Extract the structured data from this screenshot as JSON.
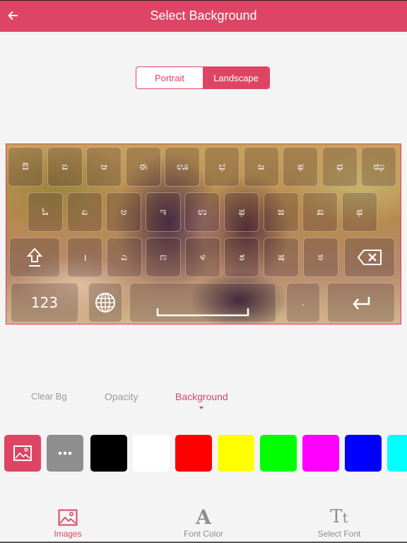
{
  "header": {
    "title": "Select Background",
    "back_icon": "arrow-left-icon"
  },
  "orientation": {
    "options": [
      "Portrait",
      "Landscape"
    ],
    "selected": "Landscape"
  },
  "keyboard": {
    "row1": [
      "ಔ",
      "ಐ",
      "ಆ",
      "ಈ",
      "ಊ",
      "ಭ",
      "ಜ",
      "ಫ",
      "ಧ",
      "ಝ"
    ],
    "row2": [
      "ಓ",
      "ಏ",
      "ಅ",
      "ಇ",
      "ಉ",
      "ಫ",
      "ಙ",
      "ಖ",
      "ಥ"
    ],
    "row3": {
      "shift_icon": "shift-icon",
      "keys": [
        "।",
        "ಎ",
        "ಣ",
        "ಳ",
        "ಶ",
        "ಷ",
        "ಠ"
      ],
      "backspace_icon": "backspace-icon"
    },
    "row4": {
      "numbers_label": "123",
      "globe_icon": "globe-icon",
      "space_icon": "space-bar-icon",
      "period": ".",
      "enter_icon": "enter-icon"
    }
  },
  "tabs": [
    {
      "label": "Clear Bg",
      "active": false
    },
    {
      "label": "Opacity",
      "active": false
    },
    {
      "label": "Background",
      "active": true
    }
  ],
  "swatches": {
    "image_button_icon": "image-icon",
    "more_button_icon": "more-dots-icon",
    "colors": [
      "#000000",
      "#ffffff",
      "#ff0000",
      "#ffff00",
      "#00ff00",
      "#ff00ff",
      "#0000ff",
      "#00ffff"
    ],
    "image_button_color": "#de4565",
    "more_button_color": "#8e8e8e"
  },
  "bottom_nav": [
    {
      "label": "Images",
      "icon": "image-icon",
      "active": true
    },
    {
      "label": "Font Color",
      "icon": "font-color-icon",
      "active": false
    },
    {
      "label": "Select Font",
      "icon": "select-font-icon",
      "active": false
    }
  ],
  "accent_color": "#de4565"
}
